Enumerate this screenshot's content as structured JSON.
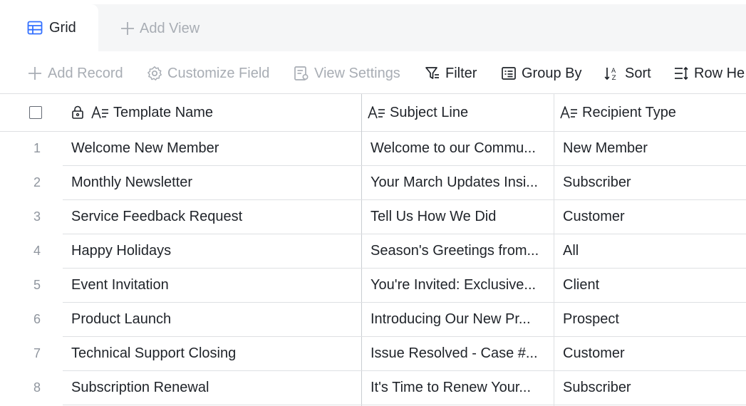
{
  "tabs": {
    "active_label": "Grid",
    "add_view_label": "Add View"
  },
  "toolbar": {
    "add_record": "Add Record",
    "customize_field": "Customize Field",
    "view_settings": "View Settings",
    "filter": "Filter",
    "group_by": "Group By",
    "sort": "Sort",
    "row_height": "Row He"
  },
  "columns": [
    {
      "label": "Template Name",
      "type_icon": "text-field-icon",
      "locked": true
    },
    {
      "label": "Subject Line",
      "type_icon": "text-field-icon"
    },
    {
      "label": "Recipient Type",
      "type_icon": "text-field-icon"
    }
  ],
  "rows": [
    {
      "index": "1",
      "name": "Welcome New Member",
      "subject": "Welcome to our Commu...",
      "recipient": "New Member"
    },
    {
      "index": "2",
      "name": "Monthly Newsletter",
      "subject": "Your March Updates Insi...",
      "recipient": "Subscriber"
    },
    {
      "index": "3",
      "name": "Service Feedback Request",
      "subject": "Tell Us How We Did",
      "recipient": "Customer"
    },
    {
      "index": "4",
      "name": "Happy Holidays",
      "subject": "Season's Greetings from...",
      "recipient": "All"
    },
    {
      "index": "5",
      "name": "Event Invitation",
      "subject": "You're Invited: Exclusive...",
      "recipient": "Client"
    },
    {
      "index": "6",
      "name": "Product Launch",
      "subject": "Introducing Our New Pr...",
      "recipient": "Prospect"
    },
    {
      "index": "7",
      "name": "Technical Support Closing",
      "subject": "Issue Resolved - Case #...",
      "recipient": "Customer"
    },
    {
      "index": "8",
      "name": "Subscription Renewal",
      "subject": "It's Time to Renew Your...",
      "recipient": "Subscriber"
    }
  ],
  "colors": {
    "accent": "#3370ff",
    "text": "#1f2329",
    "muted": "#a8adb4",
    "border": "#dee0e3",
    "tab_bg": "#f5f6f7"
  }
}
